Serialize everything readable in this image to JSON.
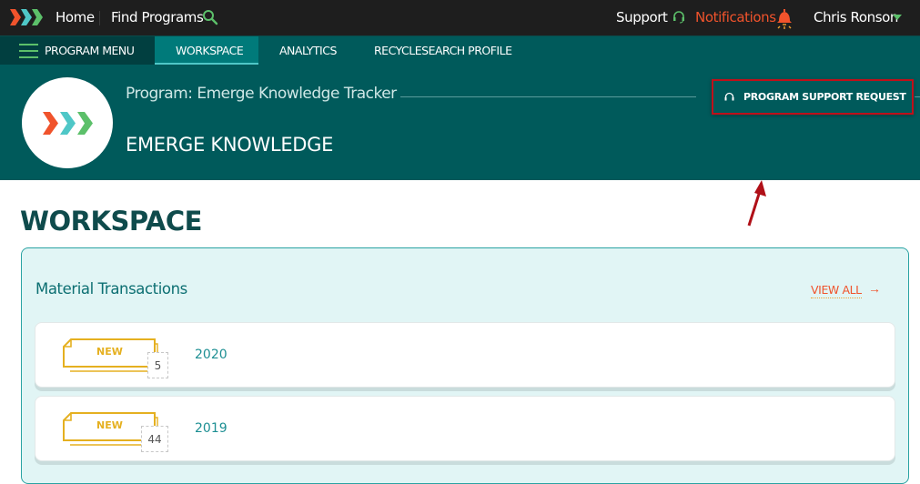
{
  "topbar": {
    "home": "Home",
    "find_programs": "Find Programs",
    "support": "Support",
    "notifications": "Notifications",
    "user_name": "Chris Ronson",
    "icons": {
      "logo": "triple-chevron-logo",
      "search": "search-icon",
      "support": "headset-icon",
      "notifications": "bell-icon",
      "user_menu": "caret-down-icon"
    }
  },
  "nav": {
    "menu_label": "PROGRAM MENU",
    "tabs": [
      {
        "label": "WORKSPACE",
        "active": true
      },
      {
        "label": "ANALYTICS",
        "active": false
      },
      {
        "label": "RECYCLESEARCH PROFILE",
        "active": false
      }
    ]
  },
  "hero": {
    "program_line": "Program: Emerge Knowledge Tracker",
    "title": "EMERGE KNOWLEDGE",
    "support_button": "PROGRAM SUPPORT REQUEST"
  },
  "workspace": {
    "title": "WORKSPACE",
    "panel": {
      "title": "Material Transactions",
      "view_all": "VIEW ALL",
      "view_all_arrow": "→",
      "rows": [
        {
          "badge": "NEW",
          "count": "5",
          "year": "2020"
        },
        {
          "badge": "NEW",
          "count": "44",
          "year": "2019"
        }
      ]
    }
  },
  "colors": {
    "topbar_bg": "#1e1e1e",
    "brand_teal": "#005a5b",
    "accent_orange": "#f0532c",
    "accent_green": "#5cc06a",
    "badge_gold": "#e5b020",
    "annotation_red": "#c0101a"
  }
}
